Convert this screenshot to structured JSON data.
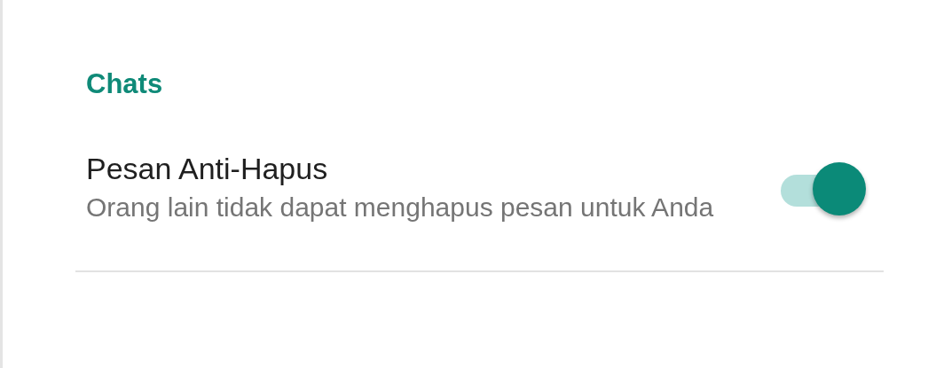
{
  "section_header": "Chats",
  "settings": [
    {
      "title": "Pesan Anti-Hapus",
      "subtitle": "Orang lain tidak dapat menghapus pesan untuk Anda",
      "on": true
    }
  ]
}
